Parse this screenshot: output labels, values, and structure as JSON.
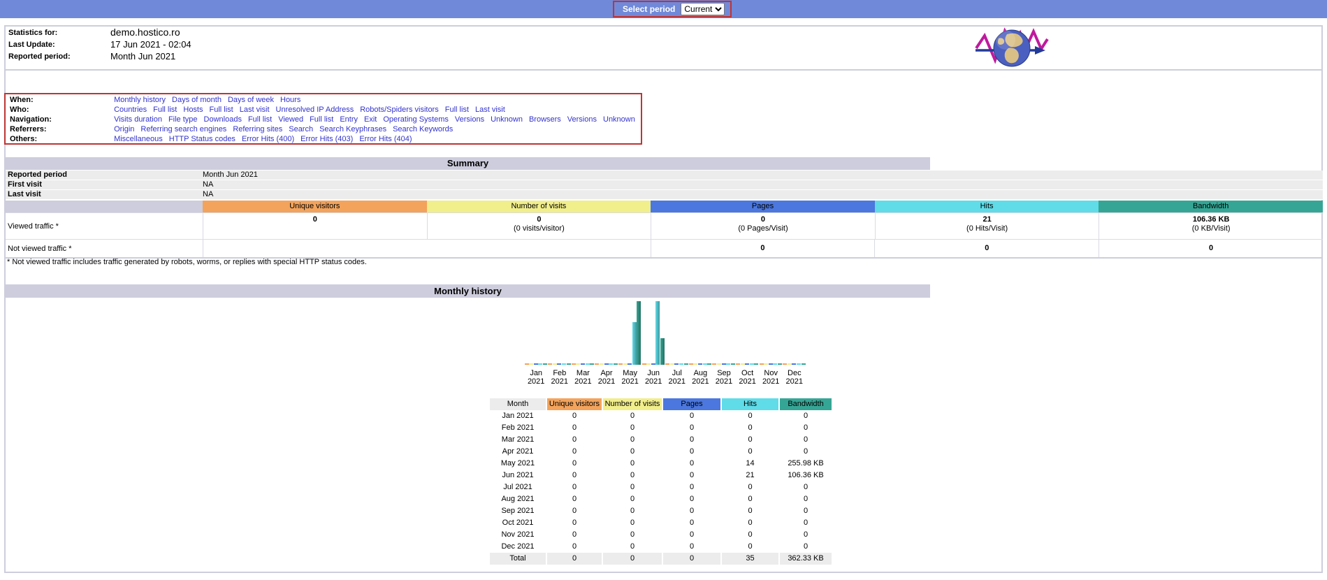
{
  "colors": {
    "top_bar": "#7189D9",
    "section_bar": "#CDCDDD",
    "highlight_border_red": "#BE3434",
    "row_gray": "#ECECEC",
    "unique_visitors": "#F3A35B",
    "number_of_visits": "#F1EE8C",
    "pages": "#4B77DE",
    "hits": "#5FDCE8",
    "bandwidth": "#35A695",
    "link": "#3333CC"
  },
  "top_bar": {
    "select_period_label": "Select period",
    "period_value": "Current"
  },
  "header": {
    "rows": [
      {
        "label": "Statistics for:",
        "value": "demo.hostico.ro"
      },
      {
        "label": "Last Update:",
        "value": "17 Jun 2021 - 02:04"
      },
      {
        "label": "Reported period:",
        "value": "Month Jun 2021"
      }
    ]
  },
  "menu": {
    "rows": [
      {
        "label": "When:",
        "links": [
          "Monthly history",
          "Days of month",
          "Days of week",
          "Hours"
        ]
      },
      {
        "label": "Who:",
        "links": [
          "Countries",
          "Full list",
          "Hosts",
          "Full list",
          "Last visit",
          "Unresolved IP Address",
          "Robots/Spiders visitors",
          "Full list",
          "Last visit"
        ]
      },
      {
        "label": "Navigation:",
        "links": [
          "Visits duration",
          "File type",
          "Downloads",
          "Full list",
          "Viewed",
          "Full list",
          "Entry",
          "Exit",
          "Operating Systems",
          "Versions",
          "Unknown",
          "Browsers",
          "Versions",
          "Unknown"
        ]
      },
      {
        "label": "Referrers:",
        "links": [
          "Origin",
          "Referring search engines",
          "Referring sites",
          "Search",
          "Search Keyphrases",
          "Search Keywords"
        ]
      },
      {
        "label": "Others:",
        "links": [
          "Miscellaneous",
          "HTTP Status codes",
          "Error Hits (400)",
          "Error Hits (403)",
          "Error Hits (404)"
        ]
      }
    ]
  },
  "summary": {
    "title": "Summary",
    "info_rows": [
      {
        "label": "Reported period",
        "value": "Month Jun 2021"
      },
      {
        "label": "First visit",
        "value": "NA"
      },
      {
        "label": "Last visit",
        "value": "NA"
      }
    ],
    "table": {
      "columns": [
        {
          "label": "Unique visitors",
          "color": "#F3A35B"
        },
        {
          "label": "Number of visits",
          "color": "#F1EE8C"
        },
        {
          "label": "Pages",
          "color": "#4B77DE"
        },
        {
          "label": "Hits",
          "color": "#5FDCE8"
        },
        {
          "label": "Bandwidth",
          "color": "#35A695"
        }
      ],
      "viewed_row": {
        "label": "Viewed traffic *",
        "cells": [
          {
            "main": "0",
            "sub": ""
          },
          {
            "main": "0",
            "sub": "(0 visits/visitor)"
          },
          {
            "main": "0",
            "sub": "(0 Pages/Visit)"
          },
          {
            "main": "21",
            "sub": "(0 Hits/Visit)"
          },
          {
            "main": "106.36 KB",
            "sub": "(0 KB/Visit)"
          }
        ]
      },
      "not_viewed_row": {
        "label": "Not viewed traffic *",
        "cells": [
          "0",
          "0",
          "0"
        ]
      }
    },
    "footnote": "* Not viewed traffic includes traffic generated by robots, worms, or replies with special HTTP status codes."
  },
  "monthly_history": {
    "title": "Monthly history",
    "table": {
      "columns": [
        {
          "label": "Month",
          "color": "#ECECEC"
        },
        {
          "label": "Unique visitors",
          "color": "#F3A35B"
        },
        {
          "label": "Number of visits",
          "color": "#F1EE8C"
        },
        {
          "label": "Pages",
          "color": "#4B77DE"
        },
        {
          "label": "Hits",
          "color": "#5FDCE8"
        },
        {
          "label": "Bandwidth",
          "color": "#35A695"
        }
      ],
      "rows": [
        [
          "Jan 2021",
          "0",
          "0",
          "0",
          "0",
          "0"
        ],
        [
          "Feb 2021",
          "0",
          "0",
          "0",
          "0",
          "0"
        ],
        [
          "Mar 2021",
          "0",
          "0",
          "0",
          "0",
          "0"
        ],
        [
          "Apr 2021",
          "0",
          "0",
          "0",
          "0",
          "0"
        ],
        [
          "May 2021",
          "0",
          "0",
          "0",
          "14",
          "255.98 KB"
        ],
        [
          "Jun 2021",
          "0",
          "0",
          "0",
          "21",
          "106.36 KB"
        ],
        [
          "Jul 2021",
          "0",
          "0",
          "0",
          "0",
          "0"
        ],
        [
          "Aug 2021",
          "0",
          "0",
          "0",
          "0",
          "0"
        ],
        [
          "Sep 2021",
          "0",
          "0",
          "0",
          "0",
          "0"
        ],
        [
          "Oct 2021",
          "0",
          "0",
          "0",
          "0",
          "0"
        ],
        [
          "Nov 2021",
          "0",
          "0",
          "0",
          "0",
          "0"
        ],
        [
          "Dec 2021",
          "0",
          "0",
          "0",
          "0",
          "0"
        ]
      ],
      "total": [
        "Total",
        "0",
        "0",
        "0",
        "35",
        "362.33 KB"
      ]
    }
  },
  "chart_data": {
    "type": "bar",
    "title": "Monthly history",
    "categories": [
      "Jan 2021",
      "Feb 2021",
      "Mar 2021",
      "Apr 2021",
      "May 2021",
      "Jun 2021",
      "Jul 2021",
      "Aug 2021",
      "Sep 2021",
      "Oct 2021",
      "Nov 2021",
      "Dec 2021"
    ],
    "series": [
      {
        "name": "Unique visitors",
        "color": "#F3A35B",
        "unit": "",
        "values": [
          0,
          0,
          0,
          0,
          0,
          0,
          0,
          0,
          0,
          0,
          0,
          0
        ]
      },
      {
        "name": "Number of visits",
        "color": "#F1EE8C",
        "unit": "",
        "values": [
          0,
          0,
          0,
          0,
          0,
          0,
          0,
          0,
          0,
          0,
          0,
          0
        ]
      },
      {
        "name": "Pages",
        "color": "#4B77DE",
        "unit": "",
        "values": [
          0,
          0,
          0,
          0,
          0,
          0,
          0,
          0,
          0,
          0,
          0,
          0
        ]
      },
      {
        "name": "Hits",
        "color": "#5FDCE8",
        "unit": "",
        "values": [
          0,
          0,
          0,
          0,
          14,
          21,
          0,
          0,
          0,
          0,
          0,
          0
        ]
      },
      {
        "name": "Bandwidth",
        "color": "#35A695",
        "unit": "KB",
        "values": [
          0,
          0,
          0,
          0,
          255.98,
          106.36,
          0,
          0,
          0,
          0,
          0,
          0
        ]
      }
    ],
    "legend_position": "none",
    "grid": false,
    "scaling": "per-series-max"
  }
}
